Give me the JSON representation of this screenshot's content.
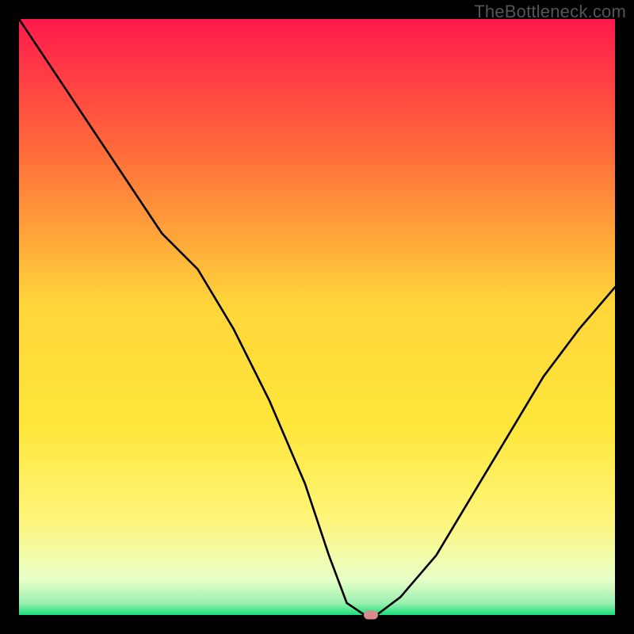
{
  "watermark": "TheBottleneck.com",
  "colors": {
    "frame": "#000000",
    "gradient_top": "#ff1a4c",
    "gradient_mid_upper": "#ff7a3c",
    "gradient_mid": "#ffd63a",
    "gradient_mid_lower": "#fff57a",
    "gradient_low": "#f3ffc0",
    "gradient_bottom": "#18e07a",
    "curve": "#000000",
    "marker": "#d98a8a"
  },
  "chart_data": {
    "type": "line",
    "title": "",
    "xlabel": "",
    "ylabel": "",
    "xlim": [
      0,
      100
    ],
    "ylim": [
      0,
      100
    ],
    "series": [
      {
        "name": "curve",
        "x": [
          0,
          6,
          12,
          18,
          24,
          30,
          36,
          42,
          48,
          52,
          55,
          58,
          60,
          64,
          70,
          76,
          82,
          88,
          94,
          100
        ],
        "y": [
          100,
          91,
          82,
          73,
          64,
          58,
          48,
          36,
          22,
          10,
          2,
          0,
          0,
          3,
          10,
          20,
          30,
          40,
          48,
          55
        ]
      }
    ],
    "marker": {
      "x": 59,
      "y": 0
    }
  }
}
